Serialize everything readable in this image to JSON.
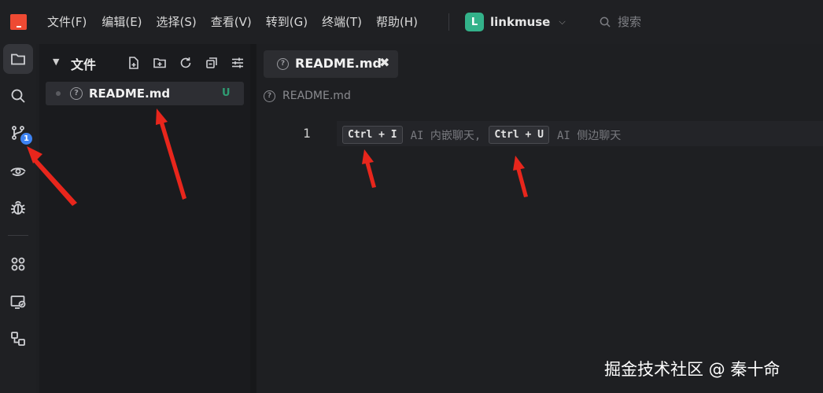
{
  "menu": {
    "items": [
      "文件(F)",
      "编辑(E)",
      "选择(S)",
      "查看(V)",
      "转到(G)",
      "终端(T)",
      "帮助(H)"
    ]
  },
  "project": {
    "avatar_letter": "L",
    "name": "linkmuse",
    "color": "#33b28a"
  },
  "search": {
    "placeholder": "搜索"
  },
  "activity_bar": {
    "items": [
      "files-icon",
      "search-icon",
      "source-control-icon",
      "eye-icon",
      "debug-icon",
      "extensions-icon",
      "remote-monitor-icon",
      "shapes-icon"
    ],
    "source_control_badge": "1"
  },
  "sidebar": {
    "title": "文件",
    "files": [
      {
        "name": "README.md",
        "status": "U"
      }
    ]
  },
  "editor": {
    "tab_label": "README.md",
    "tab_close": "✖",
    "breadcrumb": "README.md",
    "line_number": "1",
    "hint": {
      "kbd1": "Ctrl + I",
      "text1": "AI 内嵌聊天,",
      "kbd2": "Ctrl + U",
      "text2": "AI 侧边聊天"
    }
  },
  "watermark": "掘金技术社区 @ 秦十命",
  "colors": {
    "accent_red": "#ee4a33",
    "badge_blue": "#3d83f3",
    "untracked_green": "#2f9c73",
    "arrow_red": "#e8261c"
  }
}
